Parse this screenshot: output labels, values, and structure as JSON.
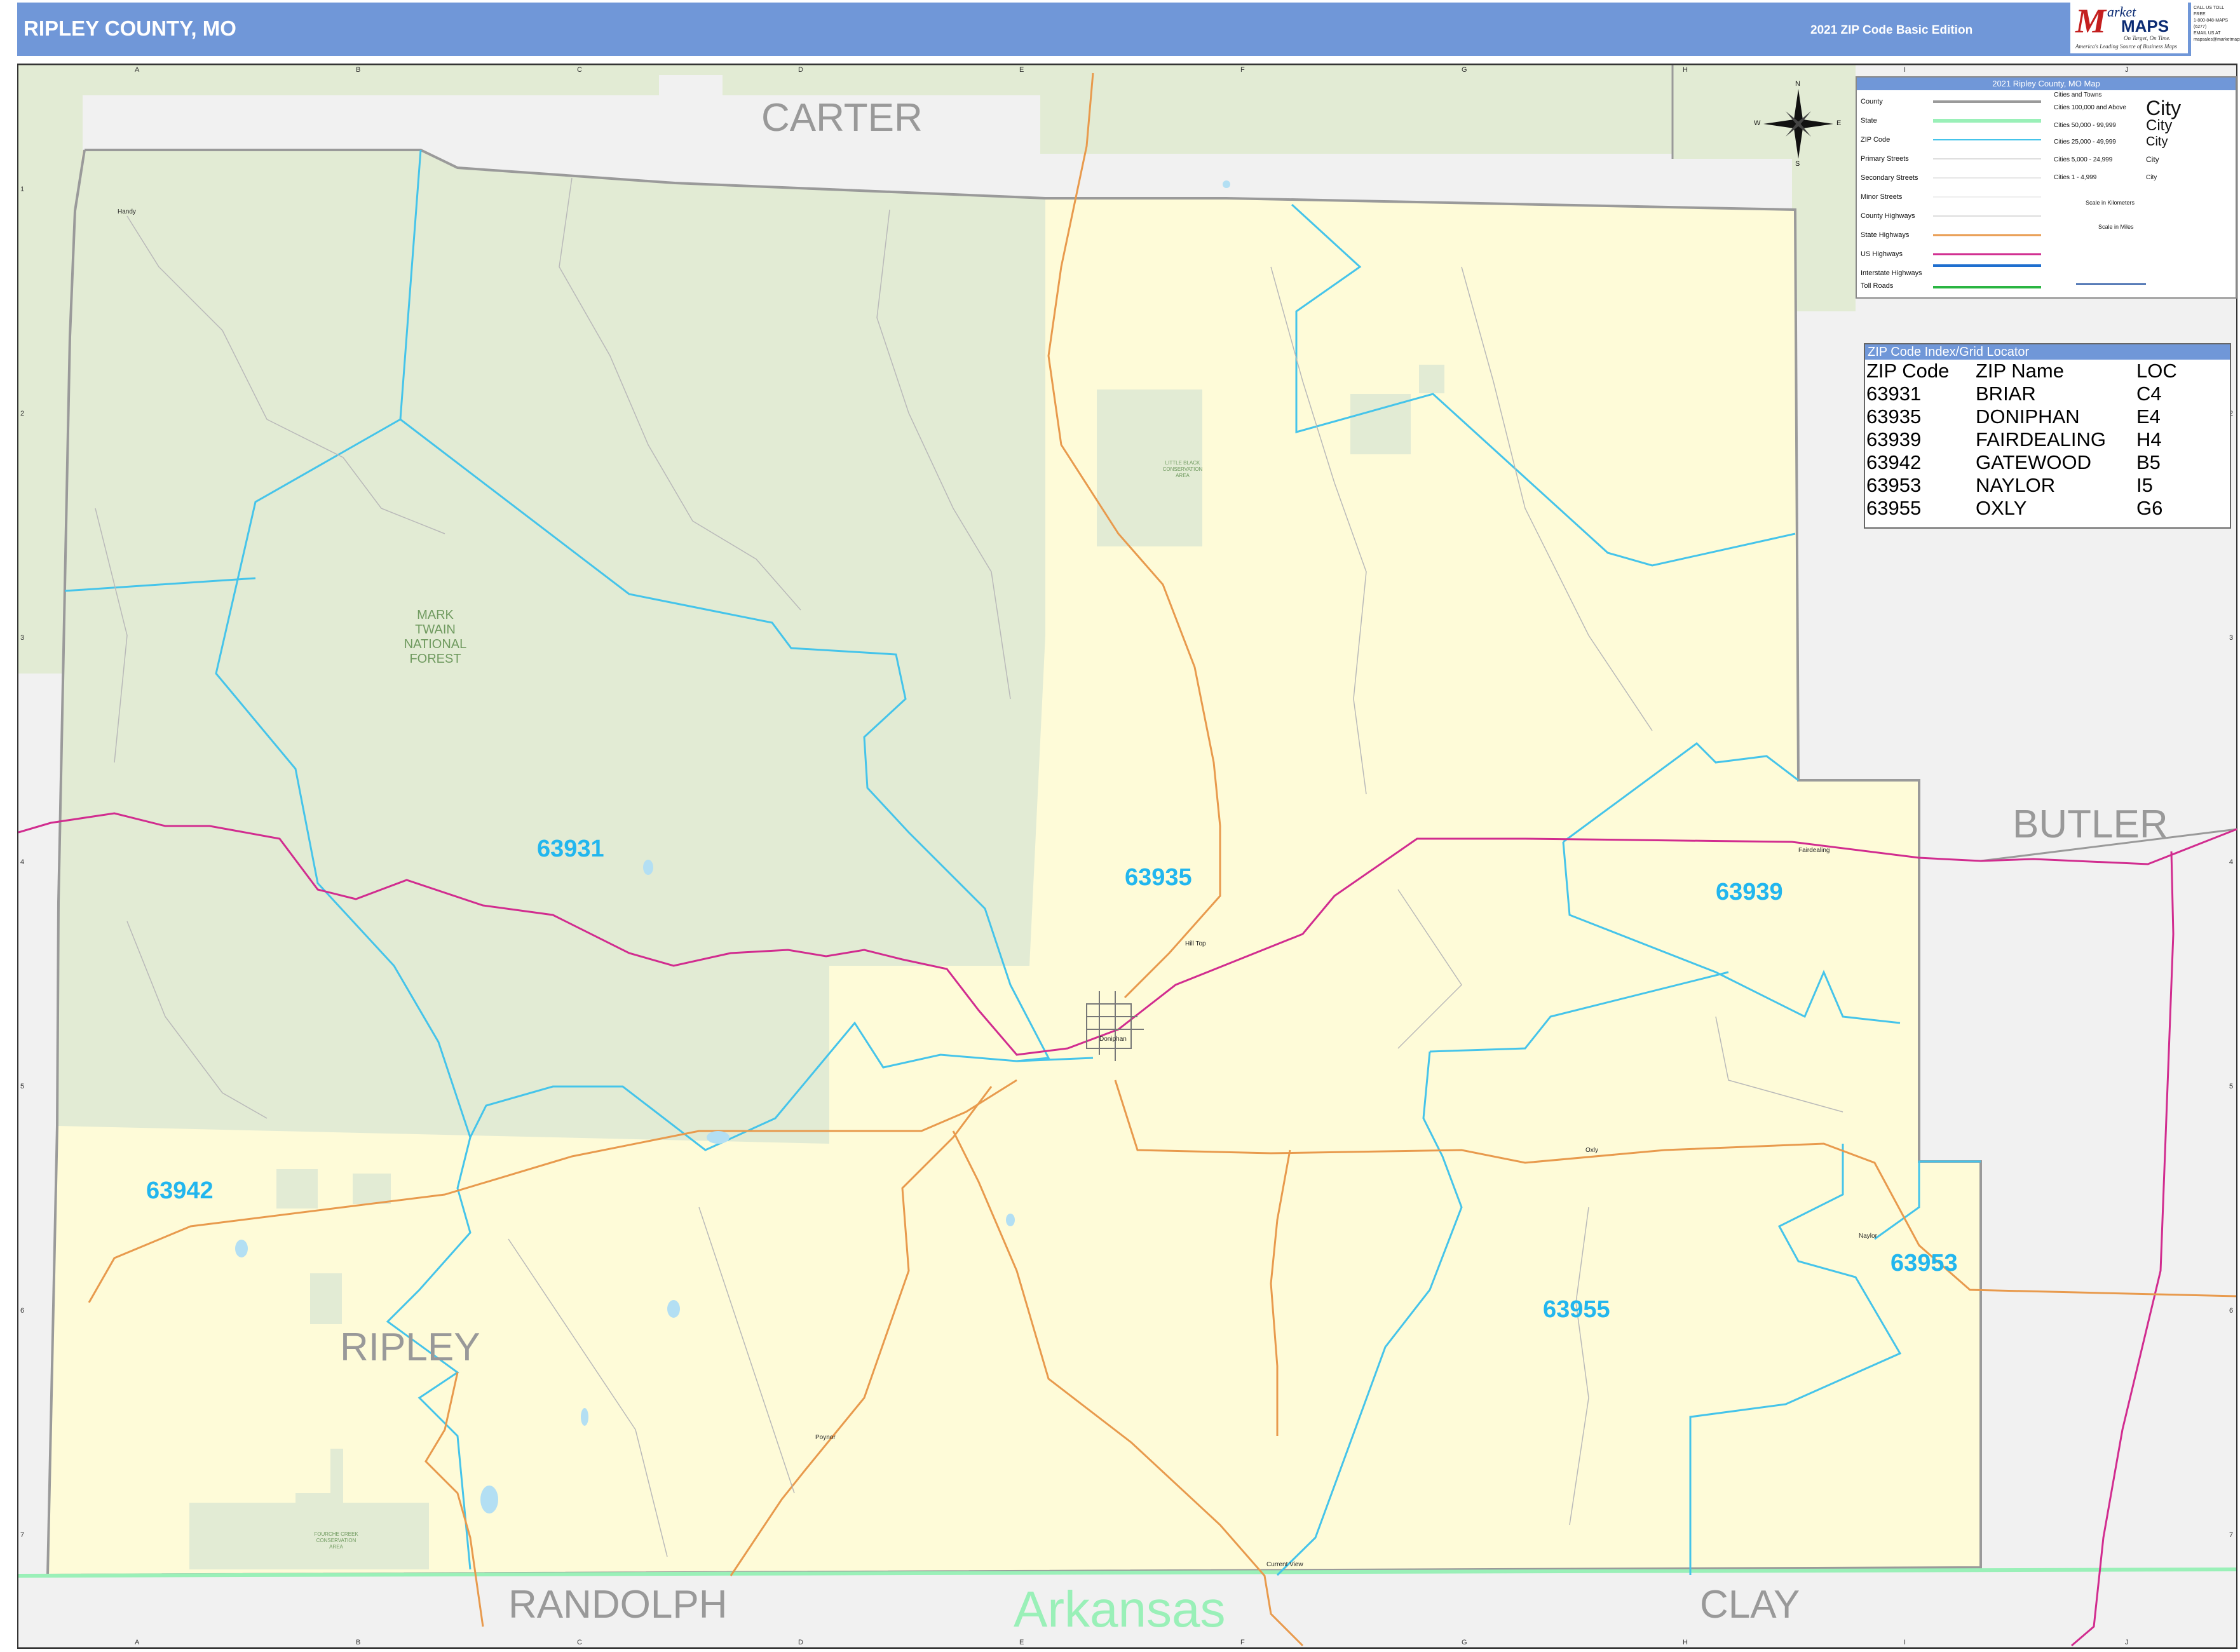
{
  "header": {
    "title": "RIPLEY COUNTY, MO",
    "edition": "2021 ZIP Code Basic Edition",
    "logo_letter": "M",
    "logo_word1": "arket",
    "logo_word2": "MAPS",
    "logo_tagline": "On Target, On Time.",
    "logo_tagline2": "America's Leading Source of Business Maps",
    "contact_lines": [
      "CALL US TOLL FREE",
      "1-800-848-MAPS (6277)",
      "EMAIL US AT",
      "mapsales@marketmaps.com"
    ]
  },
  "colors": {
    "header_blue": "#7097d8",
    "county_yellow": "#fefbd8",
    "forest_green": "#e2ebd4",
    "zip_boundary": "#45c4ea",
    "us_highway": "#d12c8f",
    "state_highway": "#e89a4d",
    "state_line": "#9af0b8",
    "outer_gray": "#f1f1f1"
  },
  "map": {
    "neighbor_labels": {
      "carter": "CARTER",
      "butler": "BUTLER",
      "randolph": "RANDOLPH",
      "clay": "CLAY",
      "ripley": "RIPLEY",
      "arkansas": "Arkansas"
    },
    "forest_label_lines": [
      "MARK",
      "TWAIN",
      "NATIONAL",
      "FOREST"
    ],
    "zip_labels": {
      "z63931": "63931",
      "z63935": "63935",
      "z63939": "63939",
      "z63942": "63942",
      "z63953": "63953",
      "z63955": "63955"
    },
    "places": {
      "handy": "Handy",
      "hill_top": "Hill Top",
      "doniphan": "Doniphan",
      "fairdealing": "Fairdealing",
      "oxly": "Oxly",
      "naylor": "Naylor",
      "poynor": "Poynor",
      "current_view": "Current View"
    },
    "area_labels": {
      "little_black": "LITTLE BLACK CONSERVATION AREA",
      "fourche": "FOURCHE CREEK CONSERVATION AREA"
    },
    "grid_cols": [
      "A",
      "B",
      "C",
      "D",
      "E",
      "F",
      "G",
      "H",
      "I",
      "J"
    ],
    "grid_rows": [
      "1",
      "2",
      "3",
      "4",
      "5",
      "6",
      "7"
    ],
    "compass": {
      "n": "N",
      "s": "S",
      "e": "E",
      "w": "W"
    }
  },
  "legend": {
    "title": "2021 Ripley County, MO Map",
    "items": [
      "County",
      "State",
      "ZIP Code",
      "Primary Streets",
      "Secondary Streets",
      "Minor Streets",
      "County Highways",
      "State Highways",
      "US Highways",
      "Interstate Highways",
      "Toll Roads"
    ],
    "cities_header": "Cities and Towns",
    "city_classes": [
      "Cities 100,000 and Above",
      "Cities 50,000 - 99,999",
      "Cities 25,000 - 49,999",
      "Cities 5,000 - 24,999",
      "Cities 1 - 4,999"
    ],
    "city_sample": "City",
    "scale_km": "Scale in Kilometers",
    "scale_mi": "Scale in Miles"
  },
  "zip_index": {
    "title": "ZIP Code Index/Grid Locator",
    "headers": [
      "ZIP Code",
      "ZIP Name",
      "LOC"
    ],
    "rows": [
      [
        "63931",
        "BRIAR",
        "C4"
      ],
      [
        "63935",
        "DONIPHAN",
        "E4"
      ],
      [
        "63939",
        "FAIRDEALING",
        "H4"
      ],
      [
        "63942",
        "GATEWOOD",
        "B5"
      ],
      [
        "63953",
        "NAYLOR",
        "I5"
      ],
      [
        "63955",
        "OXLY",
        "G6"
      ]
    ]
  }
}
